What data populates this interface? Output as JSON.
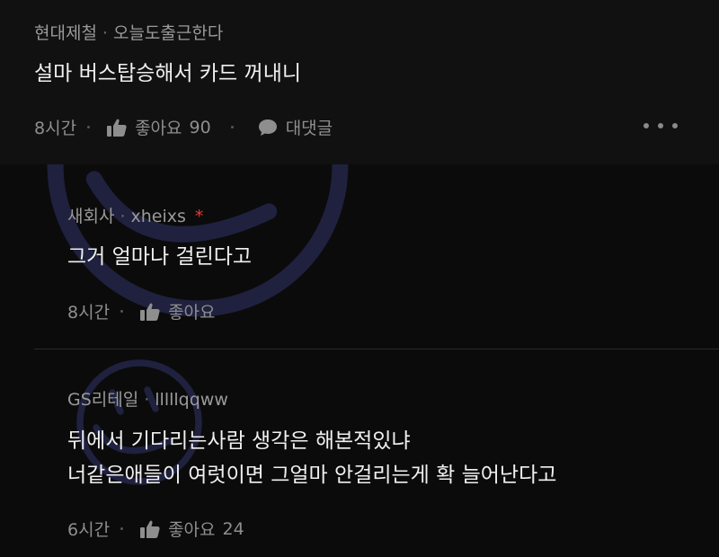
{
  "post": {
    "company": "현대제철",
    "author": "오늘도출근한다",
    "text": "설마 버스탑승해서 카드 꺼내니",
    "time": "8시간",
    "like_label": "좋아요",
    "like_count": "90",
    "reply_label": "대댓글"
  },
  "comments": [
    {
      "company": "새회사",
      "author": "xheixs",
      "author_mark": "*",
      "lines": [
        "그거 얼마나 걸린다고"
      ],
      "time": "8시간",
      "like_label": "좋아요",
      "like_count": ""
    },
    {
      "company": "GS리테일",
      "author": "lllllqqww",
      "lines": [
        "뒤에서 기다리는사람 생각은 해본적있냐",
        "너같은애들이 여럿이면 그얼마 안걸리는게 확 늘어난다고"
      ],
      "time": "6시간",
      "like_label": "좋아요",
      "like_count": "24"
    }
  ],
  "icons": {
    "like": "thumbs-up-icon",
    "reply": "speech-bubble-icon",
    "more": "more-horizontal-icon",
    "watermark": "smiley-face-icon"
  },
  "colors": {
    "background": "#0b0b0b",
    "post_background": "#111111",
    "text": "#f0f0f0",
    "meta": "#9a9a9a",
    "author_mark": "#e23b3b"
  }
}
